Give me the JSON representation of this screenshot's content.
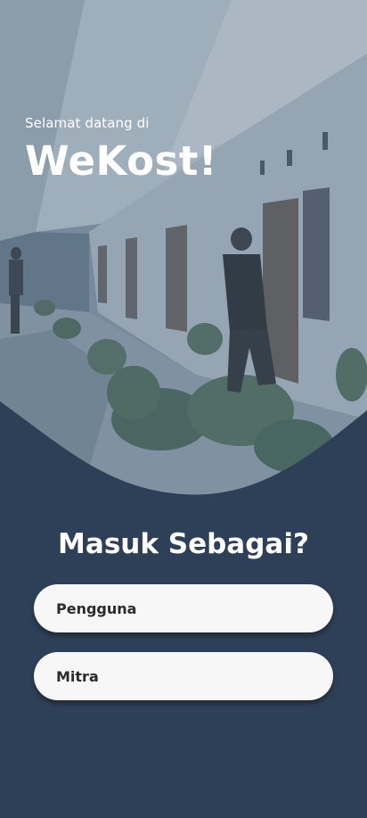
{
  "hero": {
    "greeting": "Selamat datang di",
    "brand": "WeKost!"
  },
  "login": {
    "question": "Masuk Sebagai?",
    "options": [
      {
        "label": "Pengguna"
      },
      {
        "label": "Mitra"
      }
    ]
  },
  "colors": {
    "background": "#2e4058",
    "button": "#f7f7f7",
    "button_text": "#2b2b2b"
  }
}
